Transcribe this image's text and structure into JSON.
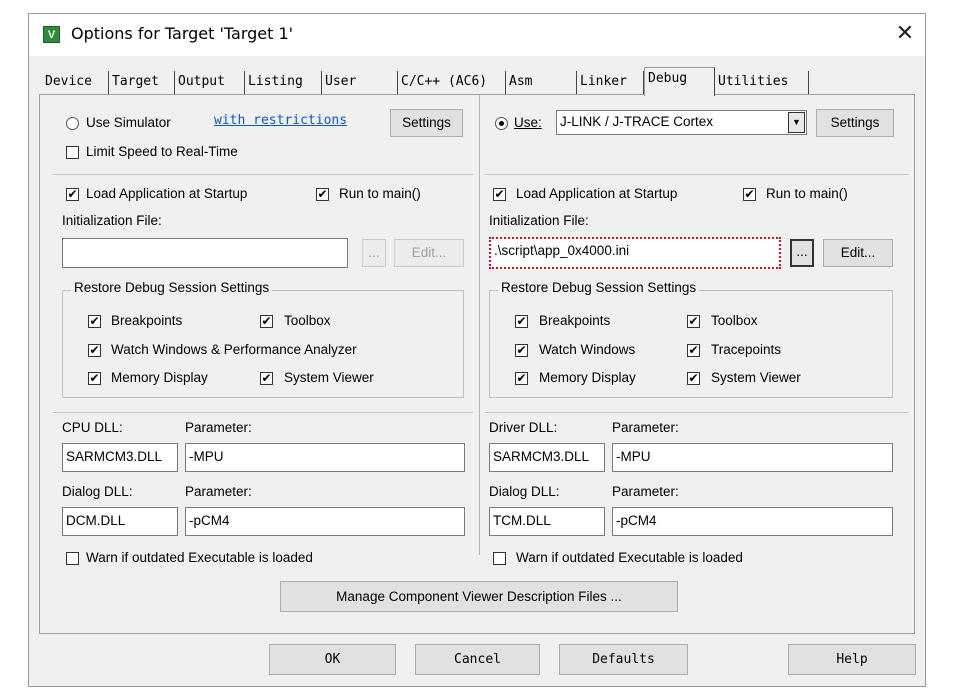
{
  "window": {
    "title": "Options for Target 'Target 1'"
  },
  "tabs": [
    {
      "label": "Device"
    },
    {
      "label": "Target"
    },
    {
      "label": "Output"
    },
    {
      "label": "Listing"
    },
    {
      "label": "User"
    },
    {
      "label": "C/C++ (AC6)"
    },
    {
      "label": "Asm"
    },
    {
      "label": "Linker"
    },
    {
      "label": "Debug"
    },
    {
      "label": "Utilities"
    }
  ],
  "left": {
    "use_simulator": "Use Simulator",
    "with_restrictions": "with restrictions",
    "settings": "Settings",
    "limit_speed": "Limit Speed to Real-Time",
    "load_app": "Load Application at Startup",
    "run_to_main": "Run to main()",
    "init_file_label": "Initialization File:",
    "init_file_value": "",
    "browse": "...",
    "edit": "Edit...",
    "restore_title": "Restore Debug Session Settings",
    "breakpoints": "Breakpoints",
    "toolbox": "Toolbox",
    "watch_windows": "Watch Windows & Performance Analyzer",
    "memory_display": "Memory Display",
    "system_viewer": "System Viewer",
    "cpu_dll_label": "CPU DLL:",
    "cpu_param_label": "Parameter:",
    "cpu_dll": "SARMCM3.DLL",
    "cpu_param": "-MPU",
    "dialog_dll_label": "Dialog DLL:",
    "dialog_param_label": "Parameter:",
    "dialog_dll": "DCM.DLL",
    "dialog_param": "-pCM4",
    "warn_outdated": "Warn if outdated Executable is loaded"
  },
  "right": {
    "use": "Use:",
    "driver_selected": "J-LINK / J-TRACE Cortex",
    "settings": "Settings",
    "load_app": "Load Application at Startup",
    "run_to_main": "Run to main()",
    "init_file_label": "Initialization File:",
    "init_file_value": ".\\script\\app_0x4000.ini",
    "browse": "...",
    "edit": "Edit...",
    "restore_title": "Restore Debug Session Settings",
    "breakpoints": "Breakpoints",
    "toolbox": "Toolbox",
    "watch_windows": "Watch Windows",
    "tracepoints": "Tracepoints",
    "memory_display": "Memory Display",
    "system_viewer": "System Viewer",
    "driver_dll_label": "Driver DLL:",
    "driver_param_label": "Parameter:",
    "driver_dll": "SARMCM3.DLL",
    "driver_param": "-MPU",
    "dialog_dll_label": "Dialog DLL:",
    "dialog_param_label": "Parameter:",
    "dialog_dll": "TCM.DLL",
    "dialog_param": "-pCM4",
    "warn_outdated": "Warn if outdated Executable is loaded"
  },
  "manage_button": "Manage Component Viewer Description Files ...",
  "footer": {
    "ok": "OK",
    "cancel": "Cancel",
    "defaults": "Defaults",
    "help": "Help"
  },
  "check_glyph": "✔",
  "colors": {
    "highlight_border": "#d0101f",
    "link": "#0b57d0"
  }
}
